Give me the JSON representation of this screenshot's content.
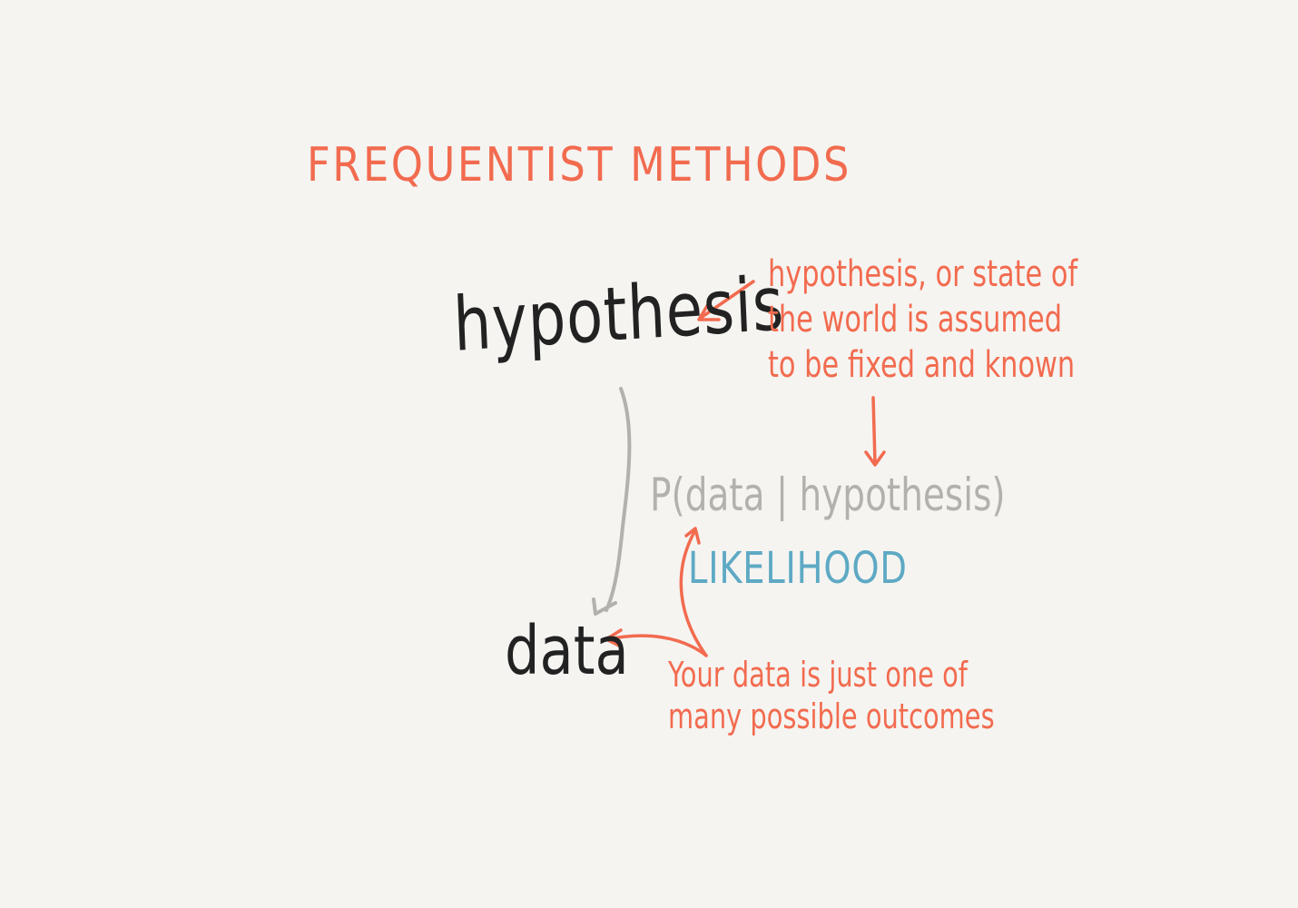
{
  "title": "FREQUENTIST METHODS",
  "nodes": {
    "hypothesis": "hypothesis",
    "data": "data"
  },
  "formula": "P(data | hypothesis)",
  "likelihood_label": "LIKELIHOOD",
  "annotations": {
    "hypothesis_note": [
      "hypothesis, or state of",
      "the world is assumed",
      "to be fixed and known"
    ],
    "data_note": [
      "Your data is just one of",
      "many possible outcomes"
    ]
  },
  "colors": {
    "background": "#f5f4f1",
    "accent": "#f26b4f",
    "ink": "#222222",
    "formula": "#b3b1ac",
    "likelihood": "#5ea9c4"
  }
}
